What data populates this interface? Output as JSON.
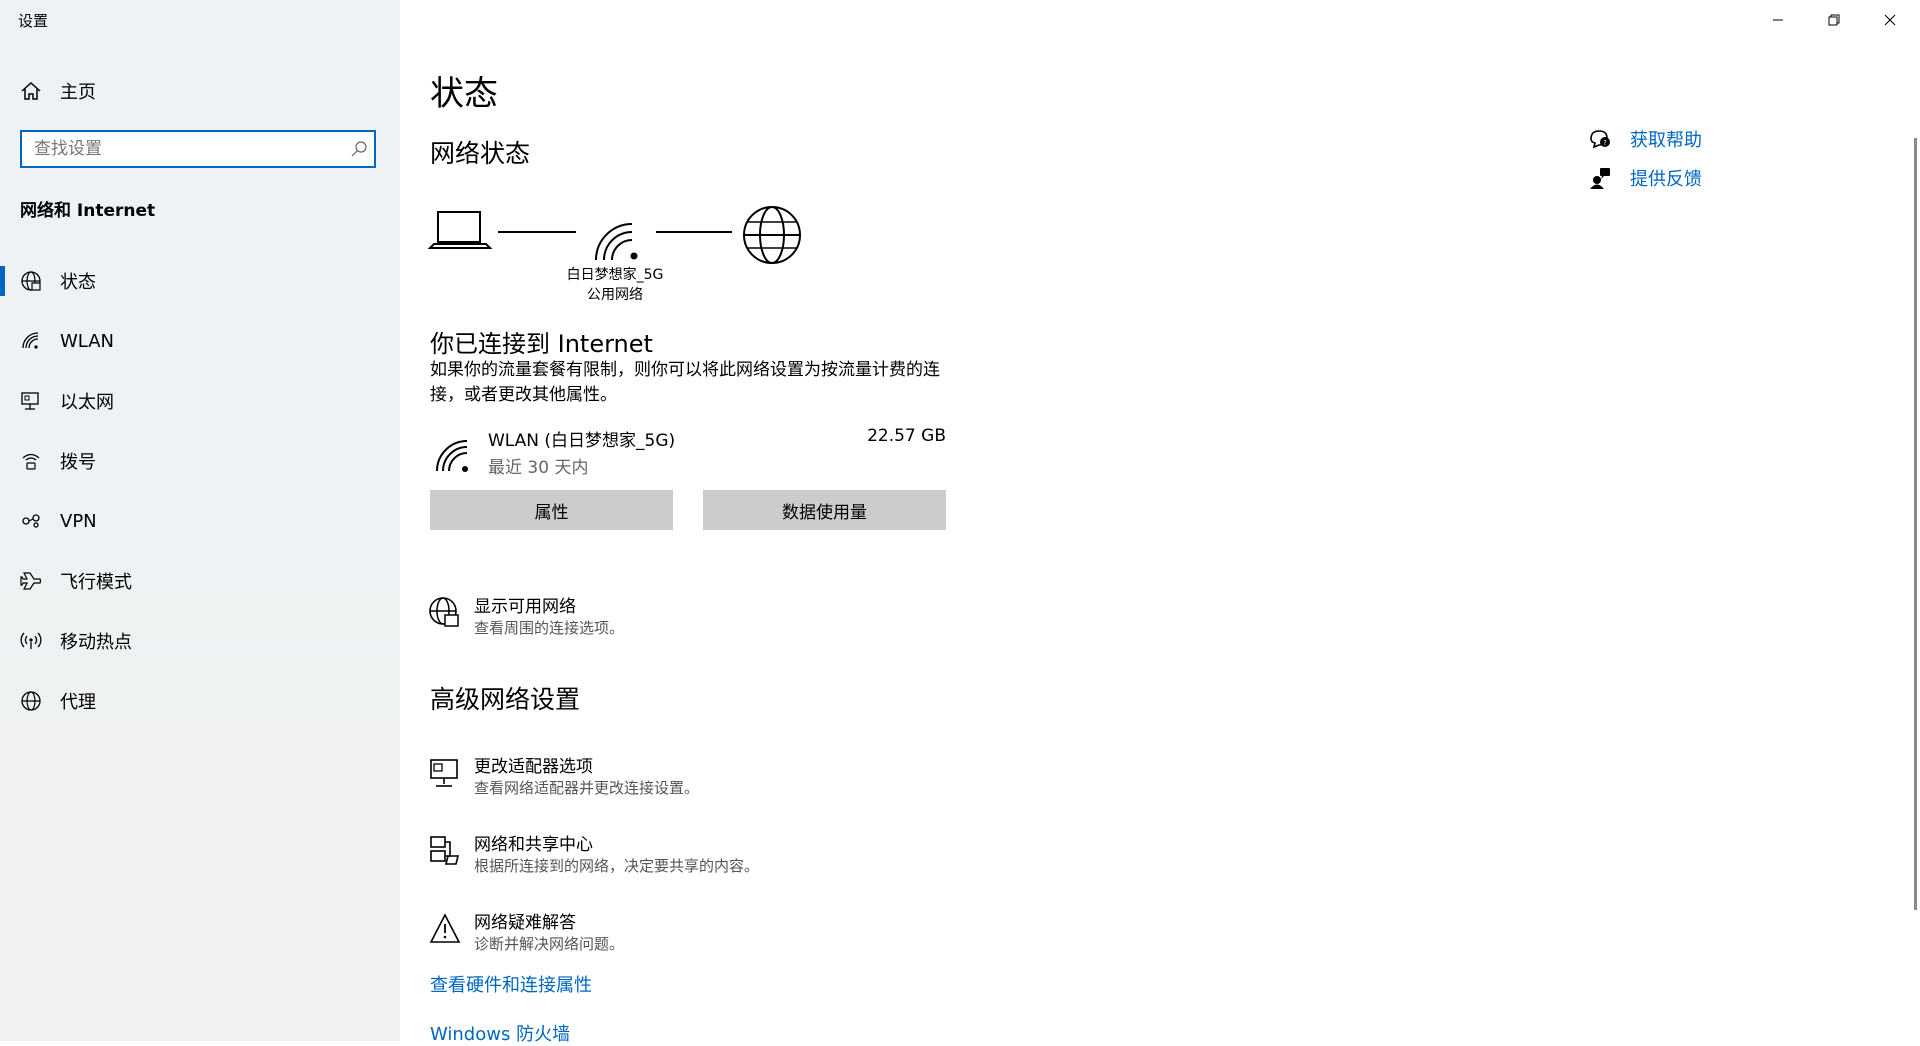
{
  "window": {
    "title": "设置",
    "controls": [
      "minimize-icon",
      "restore-icon",
      "close-icon"
    ]
  },
  "sidebar": {
    "home_label": "主页",
    "search_placeholder": "查找设置",
    "section_title": "网络和 Internet",
    "items": [
      {
        "label": "状态",
        "icon": "status-globe-icon",
        "active": true
      },
      {
        "label": "WLAN",
        "icon": "wifi-icon",
        "active": false
      },
      {
        "label": "以太网",
        "icon": "ethernet-icon",
        "active": false
      },
      {
        "label": "拨号",
        "icon": "dialup-icon",
        "active": false
      },
      {
        "label": "VPN",
        "icon": "vpn-icon",
        "active": false
      },
      {
        "label": "飞行模式",
        "icon": "airplane-icon",
        "active": false
      },
      {
        "label": "移动热点",
        "icon": "hotspot-icon",
        "active": false
      },
      {
        "label": "代理",
        "icon": "proxy-globe-icon",
        "active": false
      }
    ]
  },
  "main": {
    "title": "状态",
    "network_status_heading": "网络状态",
    "network_name": "白日梦想家_5G",
    "network_type": "公用网络",
    "connected_heading": "你已连接到 Internet",
    "description": "如果你的流量套餐有限制，则你可以将此网络设置为按流量计费的连接，或者更改其他属性。",
    "wlan": {
      "name": "WLAN (白日梦想家_5G)",
      "period": "最近 30 天内",
      "usage": "22.57 GB"
    },
    "buttons": {
      "properties": "属性",
      "data_usage": "数据使用量"
    },
    "show_networks": {
      "title": "显示可用网络",
      "subtitle": "查看周围的连接选项。"
    },
    "advanced_heading": "高级网络设置",
    "advanced_items": [
      {
        "title": "更改适配器选项",
        "subtitle": "查看网络适配器并更改连接设置。",
        "icon": "adapter-icon"
      },
      {
        "title": "网络和共享中心",
        "subtitle": "根据所连接到的网络，决定要共享的内容。",
        "icon": "sharing-center-icon"
      },
      {
        "title": "网络疑难解答",
        "subtitle": "诊断并解决网络问题。",
        "icon": "warning-icon"
      }
    ],
    "links": {
      "hardware": "查看硬件和连接属性",
      "firewall": "Windows 防火墙"
    }
  },
  "help": {
    "get_help": "获取帮助",
    "feedback": "提供反馈"
  },
  "colors": {
    "accent": "#0067c0",
    "sidebar_bg": "#eef2f5",
    "button_bg": "#cccccc"
  }
}
